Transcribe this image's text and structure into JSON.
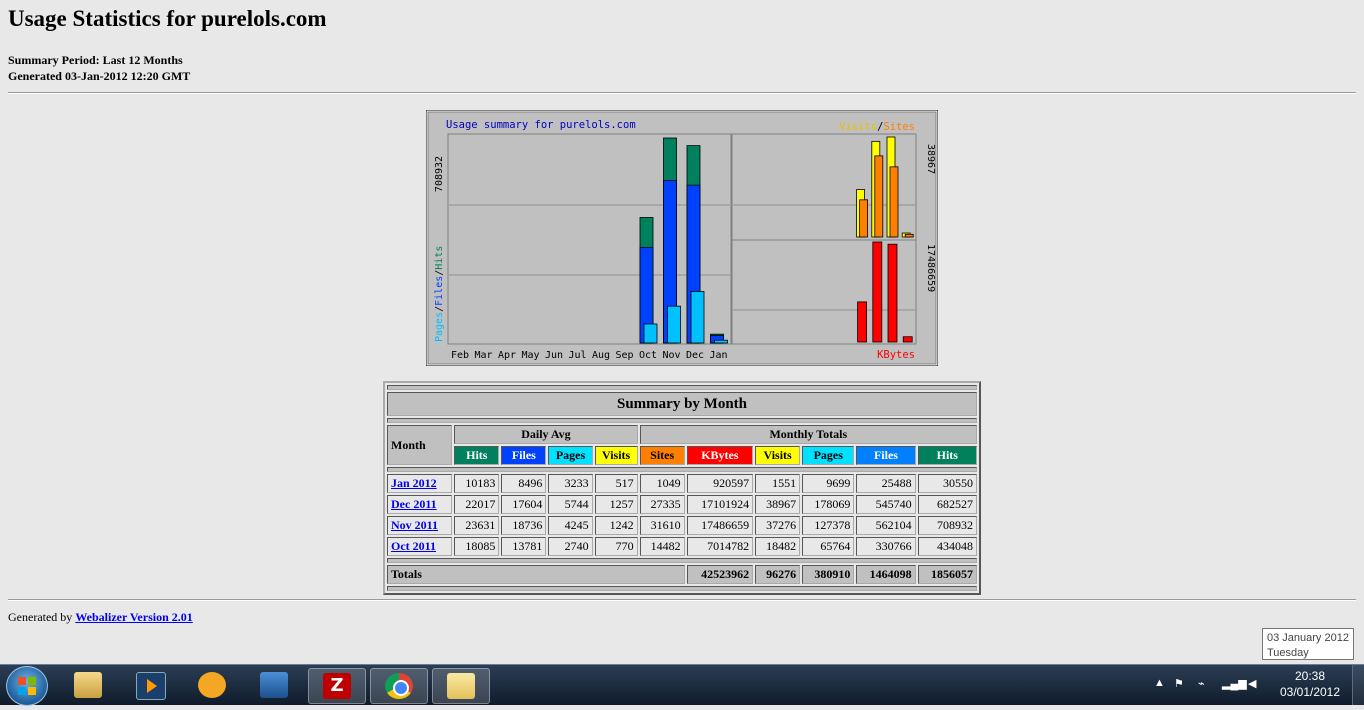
{
  "page": {
    "title": "Usage Statistics for purelols.com",
    "summary_period": "Summary Period: Last 12 Months",
    "generated": "Generated 03-Jan-2012 12:20 GMT"
  },
  "chart": {
    "title": "Usage summary for purelols.com",
    "left_axis_max": "708932",
    "left_label_pages": "Pages",
    "left_label_files": "Files",
    "left_label_hits": "Hits",
    "right_top_label_visits": "Visits",
    "right_top_label_sites": "Sites",
    "right_top_max": "38967",
    "right_bottom_max": "17486659",
    "right_bottom_label": "KBytes",
    "months": [
      "Feb",
      "Mar",
      "Apr",
      "May",
      "Jun",
      "Jul",
      "Aug",
      "Sep",
      "Oct",
      "Nov",
      "Dec",
      "Jan"
    ],
    "colors": {
      "hits": "#00805c",
      "files": "#0040ff",
      "pages": "#00c0ff",
      "visits": "#ffff00",
      "sites": "#ff8000",
      "kbytes": "#ff0000",
      "title": "#0000c0",
      "bg": "#c0c0c0"
    }
  },
  "chart_data": {
    "type": "bar",
    "categories": [
      "Feb",
      "Mar",
      "Apr",
      "May",
      "Jun",
      "Jul",
      "Aug",
      "Sep",
      "Oct",
      "Nov",
      "Dec",
      "Jan"
    ],
    "series": [
      {
        "name": "Hits",
        "values": [
          0,
          0,
          0,
          0,
          0,
          0,
          0,
          0,
          434048,
          708932,
          682527,
          30550
        ]
      },
      {
        "name": "Files",
        "values": [
          0,
          0,
          0,
          0,
          0,
          0,
          0,
          0,
          330766,
          562104,
          545740,
          25488
        ]
      },
      {
        "name": "Pages",
        "values": [
          0,
          0,
          0,
          0,
          0,
          0,
          0,
          0,
          65764,
          127378,
          178069,
          9699
        ]
      },
      {
        "name": "Visits",
        "values": [
          0,
          0,
          0,
          0,
          0,
          0,
          0,
          0,
          18482,
          37276,
          38967,
          1551
        ]
      },
      {
        "name": "Sites",
        "values": [
          0,
          0,
          0,
          0,
          0,
          0,
          0,
          0,
          14482,
          31610,
          27335,
          1049
        ]
      },
      {
        "name": "KBytes",
        "values": [
          0,
          0,
          0,
          0,
          0,
          0,
          0,
          0,
          7014782,
          17486659,
          17101924,
          920597
        ]
      }
    ],
    "title": "Usage summary for purelols.com",
    "ylim_left": [
      0,
      708932
    ],
    "ylim_visits": [
      0,
      38967
    ],
    "ylim_kbytes": [
      0,
      17486659
    ]
  },
  "table": {
    "title": "Summary by Month",
    "month_header": "Month",
    "daily_avg_header": "Daily Avg",
    "monthly_totals_header": "Monthly Totals",
    "daily_cols": [
      {
        "label": "Hits",
        "bg": "#00805c",
        "fg": "#ffffff"
      },
      {
        "label": "Files",
        "bg": "#0040ff",
        "fg": "#ffffff"
      },
      {
        "label": "Pages",
        "bg": "#00e0ff",
        "fg": "#000000"
      },
      {
        "label": "Visits",
        "bg": "#ffff00",
        "fg": "#000000"
      }
    ],
    "total_cols": [
      {
        "label": "Sites",
        "bg": "#ff8000",
        "fg": "#000000"
      },
      {
        "label": "KBytes",
        "bg": "#ff0000",
        "fg": "#ffffff"
      },
      {
        "label": "Visits",
        "bg": "#ffff00",
        "fg": "#000000"
      },
      {
        "label": "Pages",
        "bg": "#00e0ff",
        "fg": "#000000"
      },
      {
        "label": "Files",
        "bg": "#0080ff",
        "fg": "#ffffff"
      },
      {
        "label": "Hits",
        "bg": "#00805c",
        "fg": "#ffffff"
      }
    ],
    "rows": [
      {
        "month": "Jan 2012",
        "values": [
          "10183",
          "8496",
          "3233",
          "517",
          "1049",
          "920597",
          "1551",
          "9699",
          "25488",
          "30550"
        ]
      },
      {
        "month": "Dec 2011",
        "values": [
          "22017",
          "17604",
          "5744",
          "1257",
          "27335",
          "17101924",
          "38967",
          "178069",
          "545740",
          "682527"
        ]
      },
      {
        "month": "Nov 2011",
        "values": [
          "23631",
          "18736",
          "4245",
          "1242",
          "31610",
          "17486659",
          "37276",
          "127378",
          "562104",
          "708932"
        ]
      },
      {
        "month": "Oct 2011",
        "values": [
          "18085",
          "13781",
          "2740",
          "770",
          "14482",
          "7014782",
          "18482",
          "65764",
          "330766",
          "434048"
        ]
      }
    ],
    "totals_label": "Totals",
    "totals": [
      "42523962",
      "96276",
      "380910",
      "1464098",
      "1856057"
    ]
  },
  "footer": {
    "generated_by": "Generated by",
    "link": "Webalizer Version 2.01"
  },
  "tooltip": {
    "date": "03 January 2012",
    "day": "Tuesday"
  },
  "taskbar": {
    "clock_time": "20:38",
    "clock_date": "03/01/2012",
    "apps": [
      "windows-explorer-icon",
      "media-player-icon",
      "outlook-icon",
      "network-icon",
      "filezilla-icon",
      "chrome-icon",
      "folder-icon"
    ]
  }
}
